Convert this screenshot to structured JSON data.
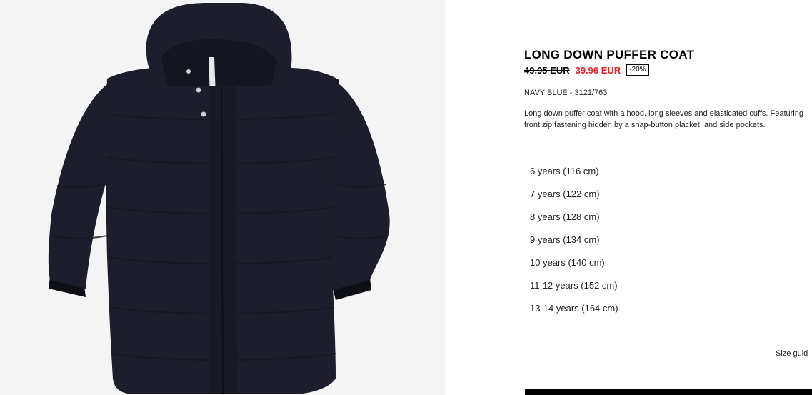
{
  "product": {
    "title": "LONG DOWN PUFFER COAT",
    "old_price": "49.95 EUR",
    "new_price": "39.96 EUR",
    "discount": "-20%",
    "color_ref": "NAVY BLUE - 3121/763",
    "description": "Long down puffer coat with a hood, long sleeves and elasticated cuffs. Featuring front zip fastening hidden by a snap-button placket, and side pockets."
  },
  "sizes": [
    "6 years (116 cm)",
    "7 years (122 cm)",
    "8 years (128 cm)",
    "9 years (134 cm)",
    "10 years (140 cm)",
    "11-12 years (152 cm)",
    "13-14 years (164 cm)"
  ],
  "size_guide_label": "Size guid",
  "colors": {
    "sale_price": "#e2222b",
    "coat": "#1c1f2b",
    "image_background": "#f4f4f4"
  }
}
